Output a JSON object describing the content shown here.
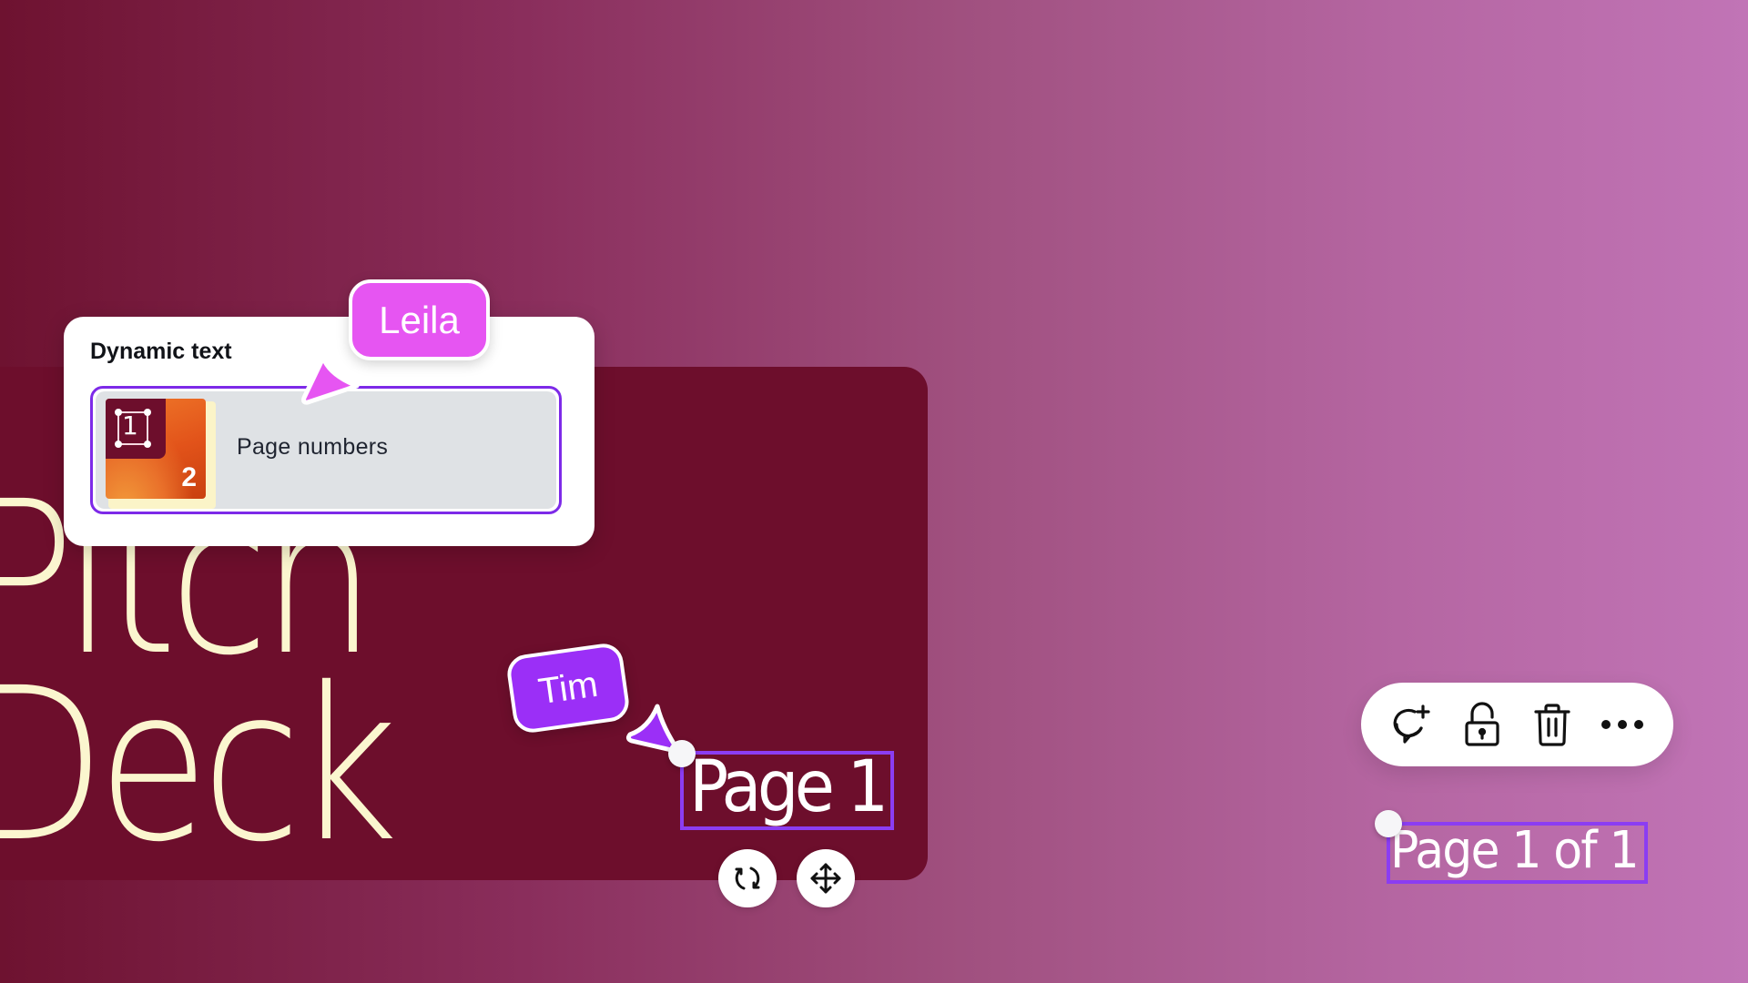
{
  "canvas": {
    "title_lines": [
      "Pitch",
      "Deck"
    ],
    "colors": {
      "background_left": "#6e1230",
      "background_right": "#c174b6",
      "slide_card": "#6d0e2c",
      "title_text": "#fbf6cf",
      "selection": "#8b3df2"
    }
  },
  "dynamic_text_panel": {
    "title": "Dynamic text",
    "items": [
      {
        "label": "Page numbers",
        "thumbnail": {
          "primary_number": "1",
          "secondary_number": "2"
        },
        "selected": true
      }
    ]
  },
  "collaborators": [
    {
      "name": "Leila",
      "color": "#e655f2"
    },
    {
      "name": "Tim",
      "color": "#9b2ff7"
    }
  ],
  "selected_elements": {
    "page_number_text": "Page 1",
    "page_of_text": "Page 1 of 1"
  },
  "element_controls": {
    "rotate_icon": "rotate-icon",
    "move_icon": "move-icon"
  },
  "floating_toolbar": {
    "buttons": [
      {
        "icon": "add-comment-icon",
        "label": "Add comment"
      },
      {
        "icon": "unlock-icon",
        "label": "Unlock"
      },
      {
        "icon": "trash-icon",
        "label": "Delete"
      },
      {
        "icon": "more-icon",
        "label": "More"
      }
    ]
  }
}
